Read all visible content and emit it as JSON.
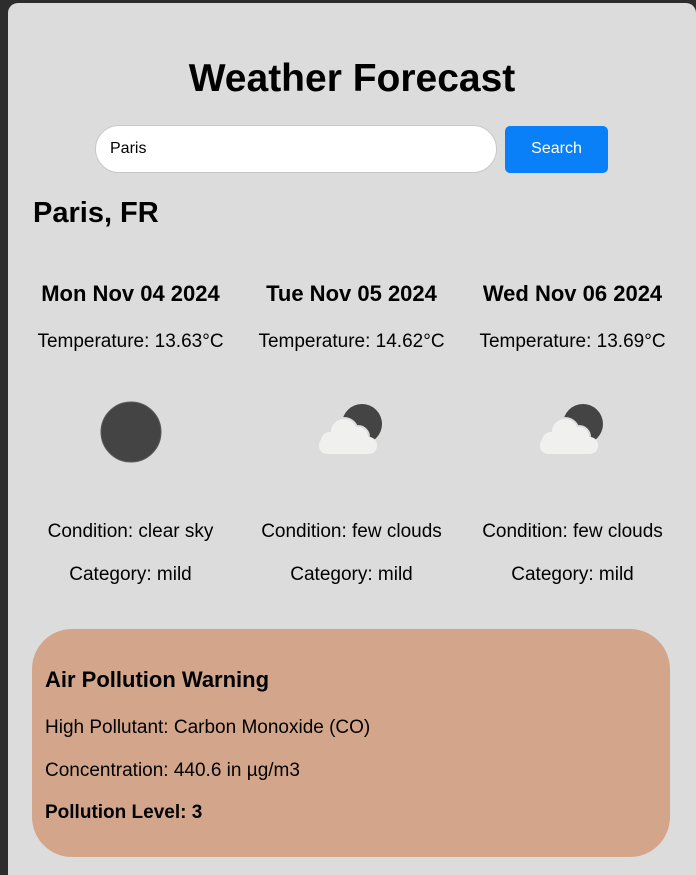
{
  "header": {
    "title": "Weather Forecast"
  },
  "search": {
    "value": "Paris",
    "button_label": "Search"
  },
  "location": {
    "title": "Paris, FR"
  },
  "forecast": {
    "days": [
      {
        "date": "Mon Nov 04 2024",
        "temperature": "Temperature: 13.63°C",
        "icon": "clear-sky-night-icon",
        "condition": "Condition: clear sky",
        "category": "Category: mild"
      },
      {
        "date": "Tue Nov 05 2024",
        "temperature": "Temperature: 14.62°C",
        "icon": "few-clouds-night-icon",
        "condition": "Condition: few clouds",
        "category": "Category: mild"
      },
      {
        "date": "Wed Nov 06 2024",
        "temperature": "Temperature: 13.69°C",
        "icon": "few-clouds-night-icon",
        "condition": "Condition: few clouds",
        "category": "Category: mild"
      }
    ]
  },
  "pollution": {
    "title": "Air Pollution Warning",
    "pollutant": "High Pollutant: Carbon Monoxide (CO)",
    "concentration": "Concentration: 440.6 in µg/m3",
    "level": "Pollution Level: 3"
  },
  "colors": {
    "page_background": "#dcdcdc",
    "accent": "#0a80f8",
    "pollution_card": "#d3a68b",
    "icon_dark": "#444444",
    "icon_cloud": "#f0f0ee"
  }
}
